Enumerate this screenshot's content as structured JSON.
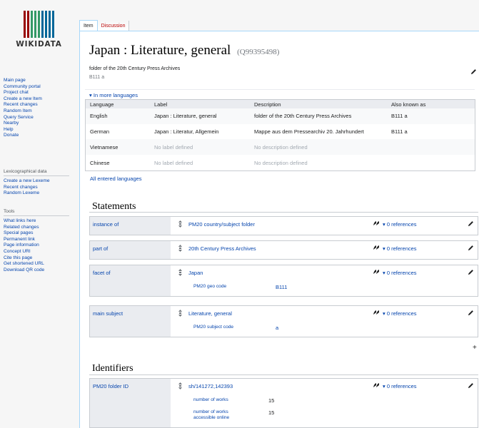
{
  "logo": {
    "text": "WIKIDATA",
    "bar_colors": [
      "#990000",
      "#990000",
      "#339966",
      "#339966",
      "#339966",
      "#006699",
      "#006699",
      "#006699",
      "#006699"
    ]
  },
  "sidebar": {
    "main_links": [
      "Main page",
      "Community portal",
      "Project chat",
      "Create a new Item",
      "Recent changes",
      "Random Item",
      "Query Service",
      "Nearby",
      "Help",
      "Donate"
    ],
    "lexeme_heading": "Lexicographical data",
    "lexeme_links": [
      "Create a new Lexeme",
      "Recent changes",
      "Random Lexeme"
    ],
    "tools_heading": "Tools",
    "tools_links": [
      "What links here",
      "Related changes",
      "Special pages",
      "Permanent link",
      "Page information",
      "Concept URI",
      "Cite this page",
      "Get shortened URL",
      "Download QR code"
    ]
  },
  "tabs": {
    "item": "Item",
    "discussion": "Discussion"
  },
  "title": {
    "label": "Japan : Literature, general",
    "qid": "(Q99395498)"
  },
  "term_box": {
    "description": "folder of the 20th Century Press Archives",
    "alias": "B111 a"
  },
  "languages": {
    "toggle": "In more languages",
    "headers": [
      "Language",
      "Label",
      "Description",
      "Also known as"
    ],
    "rows": [
      {
        "language": "English",
        "label": "Japan : Literature, general",
        "description": "folder of the 20th Century Press Archives",
        "aliases": "B111 a"
      },
      {
        "language": "German",
        "label": "Japan : Literatur, Allgemein",
        "description": "Mappe aus dem Pressearchiv 20. Jahrhundert",
        "aliases": "B111 a"
      },
      {
        "language": "Vietnamese",
        "label": "No label defined",
        "description": "No description defined",
        "aliases": ""
      },
      {
        "language": "Chinese",
        "label": "No label defined",
        "description": "No description defined",
        "aliases": ""
      }
    ],
    "all_entered": "All entered languages"
  },
  "statements_heading": "Statements",
  "statements": [
    {
      "property": "instance of",
      "value": "PM20 country/subject folder",
      "refs": "0 references",
      "qualifiers": []
    },
    {
      "property": "part of",
      "value": "20th Century Press Archives",
      "refs": "0 references",
      "qualifiers": []
    },
    {
      "property": "facet of",
      "value": "Japan",
      "refs": "0 references",
      "qualifiers": [
        {
          "property": "PM20 geo code",
          "value": "B111"
        }
      ]
    },
    {
      "property": "main subject",
      "value": "Literature, general",
      "refs": "0 references",
      "qualifiers": [
        {
          "property": "PM20 subject code",
          "value": "a"
        }
      ]
    }
  ],
  "add_symbol": "+",
  "identifiers_heading": "Identifiers",
  "identifiers": [
    {
      "property": "PM20 folder ID",
      "value": "sh/141272,142393",
      "refs": "0 references",
      "qualifiers": [
        {
          "property": "number of works",
          "value": "15"
        },
        {
          "property": "number of works accessible online",
          "value": "15"
        }
      ]
    }
  ]
}
